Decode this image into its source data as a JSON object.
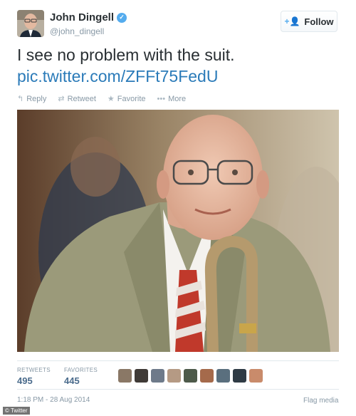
{
  "user": {
    "name": "John Dingell",
    "handle": "@john_dingell",
    "verified": true
  },
  "follow_label": "Follow",
  "tweet": {
    "text": "I see no problem with the suit.",
    "link": "pic.twitter.com/ZFFt75FedU"
  },
  "actions": {
    "reply": "Reply",
    "retweet": "Retweet",
    "favorite": "Favorite",
    "more": "More"
  },
  "stats": {
    "retweets_label": "RETWEETS",
    "retweets_count": "495",
    "favorites_label": "FAVORITES",
    "favorites_count": "445"
  },
  "favoriter_avatar_colors": [
    "#8a7866",
    "#3f3a36",
    "#6e7a8a",
    "#b59a84",
    "#4d5a4a",
    "#a56a4b",
    "#5a6f7e",
    "#2f3b45",
    "#c98b6b"
  ],
  "timestamp": "1:18 PM - 28 Aug 2014",
  "flag_label": "Flag media",
  "watermark": "© Twitter",
  "colors": {
    "link": "#2b7bb9",
    "verified": "#55acee",
    "muted": "#8899a6"
  }
}
